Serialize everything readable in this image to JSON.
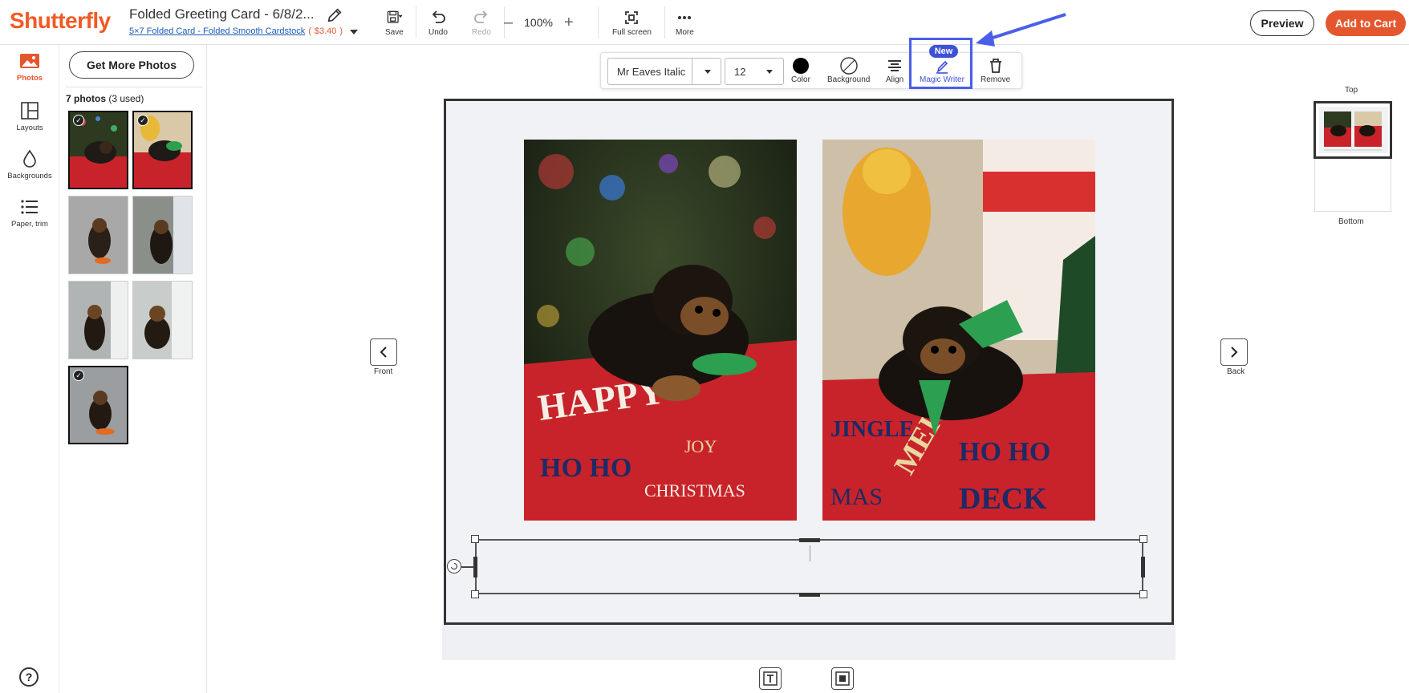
{
  "header": {
    "logo": "Shutterfly",
    "doc_title": "Folded Greeting Card - 6/8/2...",
    "product_link": "5×7 Folded Card - Folded Smooth Cardstock",
    "price_open": "(",
    "price": "$3.40",
    "price_close": ")",
    "save_label": "Save",
    "undo_label": "Undo",
    "redo_label": "Redo",
    "zoom_out": "–",
    "zoom_value": "100%",
    "zoom_in": "+",
    "fullscreen_label": "Full screen",
    "more_label": "More",
    "preview_label": "Preview",
    "cart_label": "Add to Cart"
  },
  "rail": {
    "items": [
      {
        "label": "Photos",
        "icon": "photo-icon"
      },
      {
        "label": "Layouts",
        "icon": "layout-icon"
      },
      {
        "label": "Backgrounds",
        "icon": "drop-icon"
      },
      {
        "label": "Paper, trim",
        "icon": "list-icon"
      }
    ],
    "help": "?"
  },
  "panel": {
    "get_more": "Get More Photos",
    "count_bold": "7 photos",
    "count_rest": " (3 used)",
    "check": "✓"
  },
  "text_toolbar": {
    "font": "Mr Eaves Italic",
    "size": "12",
    "color_label": "Color",
    "background_label": "Background",
    "align_label": "Align",
    "magic_label": "Magic Writer",
    "new_badge": "New",
    "remove_label": "Remove"
  },
  "nav": {
    "front": "Front",
    "back": "Back"
  },
  "pages": {
    "top": "Top",
    "bottom": "Bottom"
  },
  "colors": {
    "brand": "#f15a24",
    "accent": "#e4572e",
    "highlight": "#4a5ee8"
  }
}
